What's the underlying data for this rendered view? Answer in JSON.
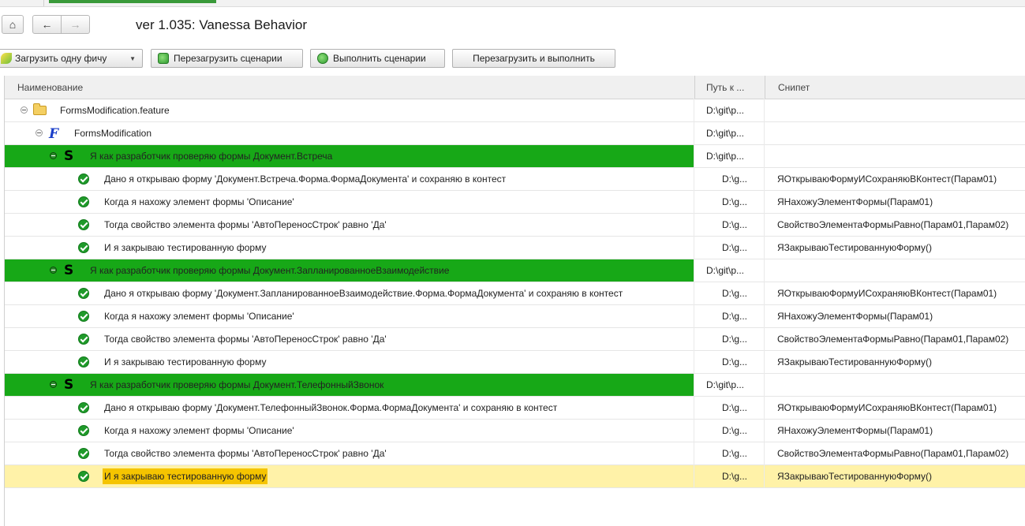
{
  "window": {
    "title": "ver 1.035: Vanessa Behavior"
  },
  "nav": {
    "home_icon": "⌂",
    "back_icon": "←",
    "forward_icon": "→"
  },
  "toolbar": {
    "load_one_label": "Загрузить одну фичу",
    "reload_label": "Перезагрузить сценарии",
    "run_label": "Выполнить сценарии",
    "reload_run_label": "Перезагрузить и выполнить"
  },
  "grid": {
    "columns": {
      "name": "Наименование",
      "path": "Путь к ...",
      "snippet": "Снипет"
    },
    "rows": [
      {
        "name": "FormsModification.feature",
        "path": "D:\\git\\p...",
        "snippet": ""
      },
      {
        "name": "FormsModification",
        "path": "D:\\git\\p...",
        "snippet": ""
      },
      {
        "name": "Я как разработчик проверяю формы Документ.Встреча",
        "path": "D:\\git\\p...",
        "snippet": ""
      },
      {
        "name": "Дано я открываю форму 'Документ.Встреча.Форма.ФормаДокумента' и сохраняю в контест",
        "path": "D:\\g...",
        "snippet": "ЯОткрываюФормуИСохраняюВКонтест(Парам01)"
      },
      {
        "name": "Когда я нахожу элемент формы 'Описание'",
        "path": "D:\\g...",
        "snippet": "ЯНахожуЭлементФормы(Парам01)"
      },
      {
        "name": "Тогда свойство элемента формы 'АвтоПереносСтрок' равно 'Да'",
        "path": "D:\\g...",
        "snippet": "СвойствоЭлементаФормыРавно(Парам01,Парам02)"
      },
      {
        "name": "И я закрываю тестированную форму",
        "path": "D:\\g...",
        "snippet": "ЯЗакрываюТестированнуюФорму()"
      },
      {
        "name": "Я как разработчик проверяю формы Документ.ЗапланированноеВзаимодействие",
        "path": "D:\\git\\p...",
        "snippet": ""
      },
      {
        "name": "Дано я открываю форму 'Документ.ЗапланированноеВзаимодействие.Форма.ФормаДокумента' и сохраняю в контест",
        "path": "D:\\g...",
        "snippet": "ЯОткрываюФормуИСохраняюВКонтест(Парам01)"
      },
      {
        "name": "Когда я нахожу элемент формы 'Описание'",
        "path": "D:\\g...",
        "snippet": "ЯНахожуЭлементФормы(Парам01)"
      },
      {
        "name": "Тогда свойство элемента формы 'АвтоПереносСтрок' равно 'Да'",
        "path": "D:\\g...",
        "snippet": "СвойствоЭлементаФормыРавно(Парам01,Парам02)"
      },
      {
        "name": "И я закрываю тестированную форму",
        "path": "D:\\g...",
        "snippet": "ЯЗакрываюТестированнуюФорму()"
      },
      {
        "name": "Я как разработчик проверяю формы Документ.ТелефонныйЗвонок",
        "path": "D:\\git\\p...",
        "snippet": ""
      },
      {
        "name": "Дано я открываю форму 'Документ.ТелефонныйЗвонок.Форма.ФормаДокумента' и сохраняю в контест",
        "path": "D:\\g...",
        "snippet": "ЯОткрываюФормуИСохраняюВКонтест(Парам01)"
      },
      {
        "name": "Когда я нахожу элемент формы 'Описание'",
        "path": "D:\\g...",
        "snippet": "ЯНахожуЭлементФормы(Парам01)"
      },
      {
        "name": "Тогда свойство элемента формы 'АвтоПереносСтрок' равно 'Да'",
        "path": "D:\\g...",
        "snippet": "СвойствоЭлементаФормыРавно(Парам01,Парам02)"
      },
      {
        "name": "И я закрываю тестированную форму",
        "path": "D:\\g...",
        "snippet": "ЯЗакрываюТестированнуюФорму()"
      }
    ]
  },
  "icons": {
    "feature_letter": "F",
    "scenario_letter": "S"
  },
  "colors": {
    "scenario_bg": "#17a817",
    "selected_row_bg": "#fff2a8",
    "selected_text_bg": "#f5c400",
    "step_ok": "#1f9a2a"
  }
}
